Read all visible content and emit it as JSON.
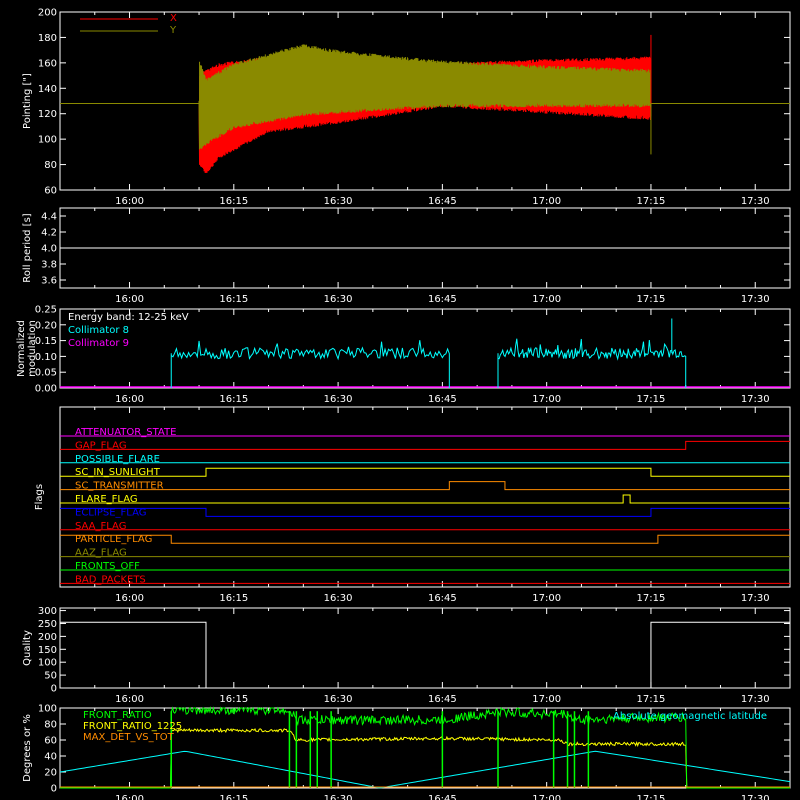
{
  "time_axis": {
    "range": [
      "15:50",
      "17:35"
    ],
    "ticks": [
      "16:00",
      "16:15",
      "16:30",
      "16:45",
      "17:00",
      "17:15",
      "17:30"
    ]
  },
  "colors": {
    "background": "#000000",
    "axes": "#ffffff",
    "red": "#ff0000",
    "olive": "#8a8a00",
    "cyan": "#00ffff",
    "magenta": "#ff00ff",
    "green": "#00ff00",
    "yellow": "#ffff00",
    "orange": "#ff8c00",
    "blue": "#0000ff",
    "white": "#ffffff"
  },
  "chart_data": [
    {
      "type": "line",
      "ylabel": "Pointing [\"]",
      "ylim": [
        60,
        200
      ],
      "yticks": [
        60,
        80,
        100,
        120,
        140,
        160,
        180,
        200
      ],
      "legend": "top-left",
      "series": [
        {
          "name": "X",
          "color": "#ff0000",
          "x": [
            "15:50",
            "16:10",
            "16:10",
            "16:11",
            "16:13",
            "16:20",
            "16:30",
            "16:45",
            "17:00",
            "17:15",
            "17:15",
            "17:35"
          ],
          "low": [
            128,
            128,
            80,
            72,
            85,
            105,
            112,
            125,
            120,
            115,
            128,
            128
          ],
          "high": [
            128,
            128,
            150,
            155,
            160,
            165,
            162,
            160,
            163,
            165,
            128,
            128
          ],
          "spike": [
            "17:15",
            182
          ]
        },
        {
          "name": "Y",
          "color": "#8a8a00",
          "x": [
            "15:50",
            "16:10",
            "16:10",
            "16:11",
            "16:15",
            "16:25",
            "16:30",
            "16:45",
            "17:00",
            "17:15",
            "17:15",
            "17:35"
          ],
          "low": [
            128,
            128,
            90,
            95,
            108,
            118,
            120,
            125,
            125,
            125,
            128,
            128
          ],
          "high": [
            128,
            128,
            163,
            148,
            160,
            175,
            170,
            162,
            158,
            155,
            128,
            128
          ]
        }
      ]
    },
    {
      "type": "line",
      "ylabel": "Roll period [s]",
      "ylim": [
        3.5,
        4.5
      ],
      "yticks": [
        3.6,
        3.8,
        4.0,
        4.2,
        4.4
      ],
      "series": [
        {
          "color": "#ffffff",
          "x": [
            "15:50",
            "17:35"
          ],
          "y": [
            4.0,
            4.0
          ]
        }
      ]
    },
    {
      "type": "line",
      "ylabel": "Normalized\nmodulation",
      "ylim": [
        0,
        0.25
      ],
      "yticks": [
        0.0,
        0.05,
        0.1,
        0.15,
        0.2,
        0.25
      ],
      "annotation": "Energy band: 12-25 keV",
      "legend": "top-left",
      "series": [
        {
          "name": "Collimator 8",
          "color": "#00ffff",
          "segments": [
            {
              "start": "16:06",
              "end": "16:46",
              "level": 0.11
            },
            {
              "start": "16:53",
              "end": "17:20",
              "level": 0.11
            }
          ],
          "peak": [
            "17:18",
            0.22
          ]
        },
        {
          "name": "Collimator 9",
          "color": "#ff00ff",
          "x": [
            "15:50",
            "17:35"
          ],
          "y": [
            0,
            0
          ]
        }
      ]
    },
    {
      "type": "line",
      "ylabel": "Flags",
      "flags": [
        {
          "name": "ATTENUATOR_STATE",
          "color": "#ff00ff",
          "steps": []
        },
        {
          "name": "GAP_FLAG",
          "color": "#ff0000",
          "steps": [
            [
              "17:20",
              1
            ]
          ]
        },
        {
          "name": "POSSIBLE_FLARE",
          "color": "#00ffff",
          "steps": []
        },
        {
          "name": "SC_IN_SUNLIGHT",
          "color": "#ffff00",
          "steps": [
            [
              "16:11",
              1
            ],
            [
              "17:15",
              0
            ]
          ]
        },
        {
          "name": "SC_TRANSMITTER",
          "color": "#ff8c00",
          "steps": [
            [
              "16:46",
              1
            ],
            [
              "16:54",
              0
            ]
          ]
        },
        {
          "name": "FLARE_FLAG",
          "color": "#ffff00",
          "steps": [
            [
              "17:11",
              1
            ],
            [
              "17:12",
              0
            ]
          ]
        },
        {
          "name": "ECLIPSE_FLAG",
          "color": "#0000ff",
          "init": 1,
          "steps": [
            [
              "16:11",
              0
            ],
            [
              "17:15",
              1
            ]
          ]
        },
        {
          "name": "SAA_FLAG",
          "color": "#ff0000",
          "steps": []
        },
        {
          "name": "PARTICLE_FLAG",
          "color": "#ff8c00",
          "init": 1,
          "steps": [
            [
              "16:06",
              0
            ],
            [
              "17:16",
              1
            ]
          ]
        },
        {
          "name": "AAZ_FLAG",
          "color": "#8a8a00",
          "steps": []
        },
        {
          "name": "FRONTS_OFF",
          "color": "#00ff00",
          "steps": []
        },
        {
          "name": "BAD_PACKETS",
          "color": "#ff0000",
          "steps": []
        }
      ]
    },
    {
      "type": "line",
      "ylabel": "Quality",
      "ylim": [
        0,
        310
      ],
      "yticks": [
        0,
        50,
        100,
        150,
        200,
        250,
        300
      ],
      "series": [
        {
          "color": "#ffffff",
          "x": [
            "15:50",
            "16:11",
            "16:11",
            "17:15",
            "17:15",
            "17:35"
          ],
          "y": [
            255,
            255,
            0,
            0,
            255,
            255
          ]
        }
      ]
    },
    {
      "type": "line",
      "ylabel": "Degrees or %",
      "ylim": [
        0,
        100
      ],
      "yticks": [
        0,
        20,
        40,
        60,
        80,
        100
      ],
      "legend": "top-left",
      "annotation": "Absolute geomagnetic latitude",
      "series": [
        {
          "name": "FRONT_RATIO",
          "color": "#00ff00",
          "x": [
            "15:50",
            "16:06",
            "16:06",
            "16:23",
            "16:24",
            "16:30",
            "16:45",
            "16:53",
            "17:03",
            "17:04",
            "17:15",
            "17:20",
            "17:20",
            "17:35"
          ],
          "y": [
            0,
            0,
            98,
            98,
            85,
            85,
            85,
            95,
            92,
            85,
            88,
            88,
            0,
            0
          ]
        },
        {
          "name": "FRONT_RATIO_1225",
          "color": "#ffff00",
          "x": [
            "15:50",
            "16:06",
            "16:06",
            "16:23",
            "16:24",
            "16:45",
            "17:02",
            "17:03",
            "17:20",
            "17:20",
            "17:35"
          ],
          "y": [
            0,
            0,
            72,
            72,
            60,
            62,
            60,
            55,
            55,
            0,
            0
          ]
        },
        {
          "name": "MAX_DET_VS_TOT",
          "color": "#ff8c00",
          "x": [
            "15:50",
            "17:35"
          ],
          "y": [
            0,
            0
          ]
        },
        {
          "name": "Absolute geomagnetic latitude",
          "color": "#00ffff",
          "x": [
            "15:50",
            "16:08",
            "16:36",
            "17:07",
            "17:35"
          ],
          "y": [
            20,
            46,
            0,
            46,
            8
          ]
        }
      ]
    }
  ]
}
